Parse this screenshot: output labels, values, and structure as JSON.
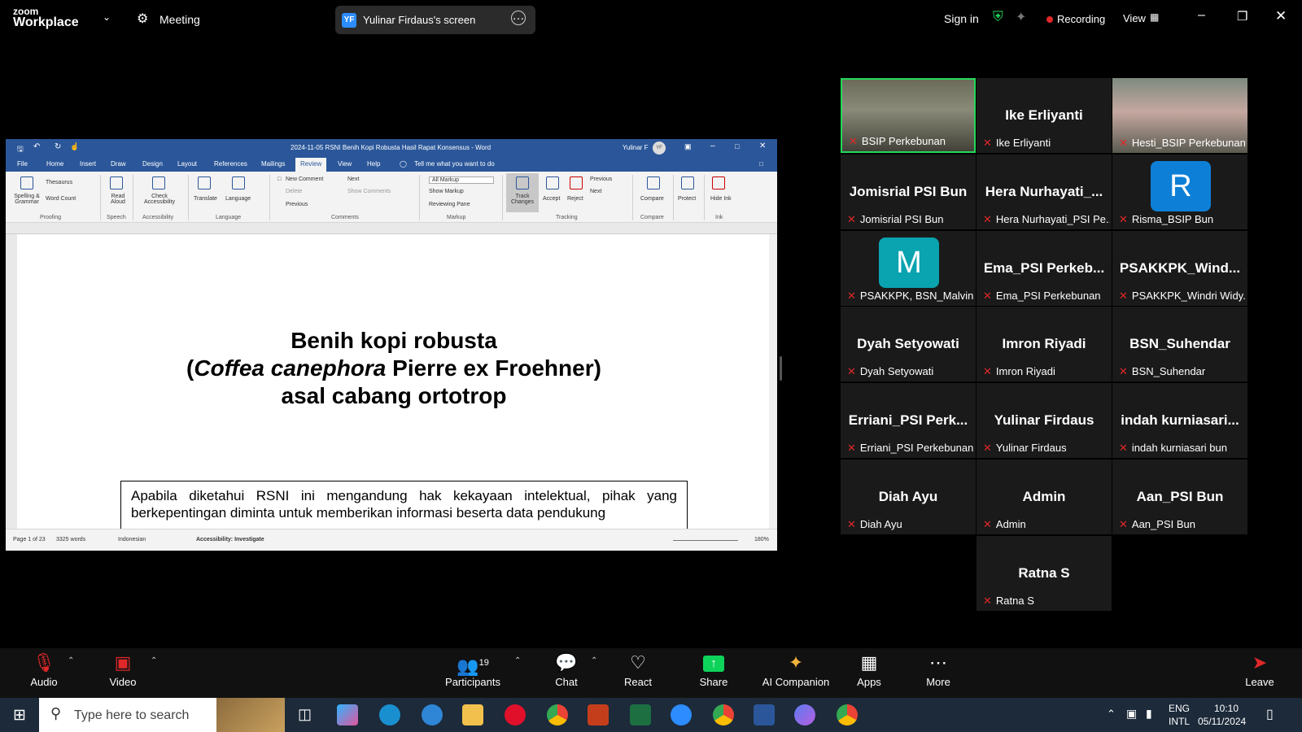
{
  "app": {
    "brand_top": "zoom",
    "brand_bottom": "Workplace",
    "meeting_label": "Meeting"
  },
  "share": {
    "badge": "YF",
    "label": "Yulinar Firdaus's screen"
  },
  "topbar": {
    "sign_in": "Sign in",
    "recording": "Recording",
    "view": "View"
  },
  "word": {
    "title": "2024-11-05 RSNI Benih Kopi Robusta Hasil Rapat Konsensus - Word",
    "user": "Yulinar F",
    "user_badge": "YF",
    "tabs": [
      "File",
      "Home",
      "Insert",
      "Draw",
      "Design",
      "Layout",
      "References",
      "Mailings",
      "Review",
      "View",
      "Help"
    ],
    "tell_me": "Tell me what you want to do",
    "ribbon": {
      "spelling": "Spelling & Grammar",
      "thesaurus": "Thesaurus",
      "word_count": "Word Count",
      "read_aloud": "Read Aloud",
      "check_access": "Check Accessibility",
      "translate": "Translate",
      "language": "Language",
      "new_comment": "New Comment",
      "delete": "Delete",
      "previous": "Previous",
      "next": "Next",
      "show_comments": "Show Comments",
      "all_markup": "All Markup",
      "show_markup": "Show Markup",
      "reviewing_pane": "Reviewing Pane",
      "track_changes": "Track Changes",
      "accept": "Accept",
      "reject": "Reject",
      "prev2": "Previous",
      "next2": "Next",
      "compare": "Compare",
      "protect": "Protect",
      "hide_ink": "Hide Ink",
      "groups": [
        "Proofing",
        "Speech",
        "Accessibility",
        "Language",
        "Comments",
        "Markup",
        "Tracking",
        "Compare",
        "Ink"
      ]
    },
    "doc": {
      "line1": "Benih kopi robusta",
      "line2_open": "(",
      "line2_italic": "Coffea canephora",
      "line2_rest": " Pierre ex Froehner)",
      "line3": "asal cabang ortotrop",
      "box_text": "Apabila diketahui RSNI ini mengandung hak kekayaan intelektual, pihak yang berkepentingan diminta untuk memberikan informasi beserta data pendukung"
    },
    "status": {
      "page": "Page 1 of 23",
      "words": "3325 words",
      "language": "Indonesian",
      "accessibility": "Accessibility: Investigate",
      "zoom": "180%"
    }
  },
  "participants": [
    {
      "big": "",
      "name": "BSIP Perkebunan",
      "photo": true,
      "active": true
    },
    {
      "big": "Ike Erliyanti",
      "name": "Ike Erliyanti"
    },
    {
      "big": "",
      "name": "Hesti_BSIP Perkebunan",
      "photo": true
    },
    {
      "big": "Jomisrial PSI Bun",
      "name": "Jomisrial PSI Bun"
    },
    {
      "big": "Hera Nurhayati_...",
      "name": "Hera Nurhayati_PSI Pe..."
    },
    {
      "big": "",
      "name": "Risma_BSIP Bun",
      "avatar": "R",
      "avatar_color": "#0e7fd6"
    },
    {
      "big": "",
      "name": "PSAKKPK, BSN_Malvins",
      "avatar": "M",
      "avatar_color": "#0aa3b0"
    },
    {
      "big": "Ema_PSI Perkeb...",
      "name": "Ema_PSI Perkebunan"
    },
    {
      "big": "PSAKKPK_Wind...",
      "name": "PSAKKPK_Windri Widy..."
    },
    {
      "big": "Dyah Setyowati",
      "name": "Dyah Setyowati"
    },
    {
      "big": "Imron Riyadi",
      "name": "Imron Riyadi"
    },
    {
      "big": "BSN_Suhendar",
      "name": "BSN_Suhendar"
    },
    {
      "big": "Erriani_PSI Perk...",
      "name": "Erriani_PSI Perkebunan"
    },
    {
      "big": "Yulinar Firdaus",
      "name": "Yulinar Firdaus"
    },
    {
      "big": "indah kurniasari...",
      "name": "indah kurniasari bun"
    },
    {
      "big": "Diah Ayu",
      "name": "Diah Ayu"
    },
    {
      "big": "Admin",
      "name": "Admin"
    },
    {
      "big": "Aan_PSI Bun",
      "name": "Aan_PSI Bun"
    },
    {
      "big": "Ratna S",
      "name": "Ratna S"
    }
  ],
  "toolbar": {
    "audio": "Audio",
    "video": "Video",
    "participants": "Participants",
    "participants_count": "19",
    "chat": "Chat",
    "react": "React",
    "share": "Share",
    "ai": "AI Companion",
    "apps": "Apps",
    "more": "More",
    "leave": "Leave"
  },
  "taskbar": {
    "search_placeholder": "Type here to search",
    "lang1": "ENG",
    "lang2": "INTL",
    "time": "10:10",
    "date": "05/11/2024"
  },
  "colors": {
    "word_blue": "#2b579a",
    "zoom_blue": "#2d8cff",
    "active_green": "#23d959",
    "muted_red": "#e02828",
    "share_green": "#0ed35a"
  }
}
